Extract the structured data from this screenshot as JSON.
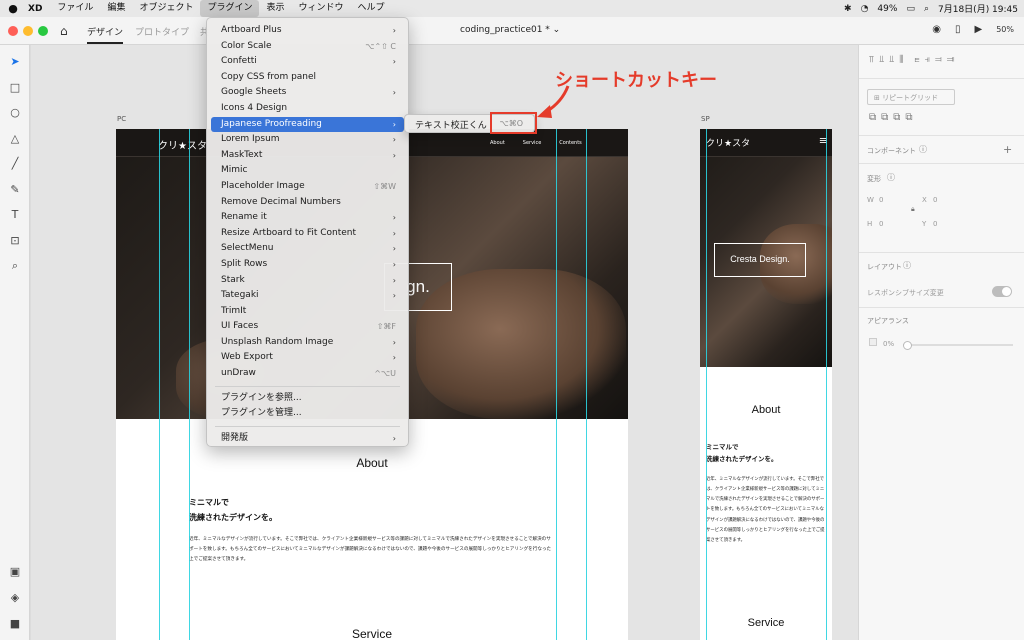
{
  "menubar": {
    "app_name": "XD",
    "items": [
      "ファイル",
      "編集",
      "オブジェクト",
      "プラグイン",
      "表示",
      "ウィンドウ",
      "ヘルプ"
    ],
    "status": {
      "battery": "49%",
      "clock": "7月18日(月)  19:45"
    }
  },
  "toolbar": {
    "tabs": [
      "デザイン",
      "プロトタイプ",
      "共"
    ],
    "document_title": "coding_practice01 *",
    "zoom": "50%"
  },
  "plugin_menu": {
    "items": [
      {
        "label": "Artboard Plus",
        "submenu": true
      },
      {
        "label": "Color Scale",
        "shortcut": "⌥⌃⇧ C"
      },
      {
        "label": "Confetti",
        "submenu": true
      },
      {
        "label": "Copy CSS from panel"
      },
      {
        "label": "Google Sheets",
        "submenu": true
      },
      {
        "label": "Icons 4 Design"
      },
      {
        "label": "Japanese Proofreading",
        "submenu": true,
        "highlighted": true
      },
      {
        "label": "Lorem Ipsum",
        "submenu": true
      },
      {
        "label": "MaskText",
        "submenu": true
      },
      {
        "label": "Mimic"
      },
      {
        "label": "Placeholder Image",
        "shortcut": "⇧⌘W"
      },
      {
        "label": "Remove Decimal Numbers"
      },
      {
        "label": "Rename it",
        "submenu": true
      },
      {
        "label": "Resize Artboard to Fit Content",
        "submenu": true
      },
      {
        "label": "SelectMenu",
        "submenu": true
      },
      {
        "label": "Split Rows",
        "submenu": true
      },
      {
        "label": "Stark",
        "submenu": true
      },
      {
        "label": "Tategaki",
        "submenu": true
      },
      {
        "label": "TrimIt"
      },
      {
        "label": "UI Faces",
        "shortcut": "⇧⌘F"
      },
      {
        "label": "Unsplash Random Image",
        "submenu": true
      },
      {
        "label": "Web Export",
        "submenu": true
      },
      {
        "label": "unDraw",
        "shortcut": "^⌥U"
      }
    ],
    "footer_items": [
      "プラグインを参照...",
      "プラグインを管理..."
    ],
    "dev_item": "開発版",
    "submenu": {
      "label": "テキスト校正くん",
      "shortcut": "⌥⌘O"
    }
  },
  "annotation": {
    "text": "ショートカットキー",
    "color": "#e53b2a"
  },
  "artboards": {
    "pc": {
      "label": "PC",
      "logo": "クリ★スタ",
      "nav": [
        "About",
        "Service",
        "Contents"
      ],
      "hero_title": "gn.",
      "about_title": "About",
      "heading": [
        "ミニマルで",
        "洗練されたデザインを。"
      ],
      "body": "近年、ミニマルなデザインが流行しています。そこで弊社では、クライアント企業様新規サービス等の課題に対してミニマルで洗練されたデザインを実現させることで解決のサポートを致します。もちろん全てのサービスにおいてミニマルなデザインが課題解決になるわけではないので、課題や今後のサービスの展開等しっかりとヒアリングを行なった上でご提案させて頂きます。",
      "service_title": "Service"
    },
    "sp": {
      "label": "SP",
      "logo": "クリ★スタ",
      "hero_title": "Cresta Design.",
      "about_title": "About",
      "heading": [
        "ミニマルで",
        "洗練されたデザインを。"
      ],
      "body": "近年、ミニマルなデザインが流行しています。そこで弊社では、クライアント企業様新規サービス等の課題に対してミニマルで洗練されたデザインを実現させることで解決のサポートを致します。もちろん全てのサービスにおいてミニマルなデザインが課題解決になるわけではないので、課題や今後のサービスの展開等しっかりとヒアリングを行なった上でご提案させて頂きます。",
      "service_title": "Service"
    }
  },
  "right_panel": {
    "repeat_grid": "リピートグリッド",
    "component": "コンポーネント",
    "transform": "変形",
    "w_label": "W",
    "w_value": "0",
    "x_label": "X",
    "x_value": "0",
    "h_label": "H",
    "h_value": "0",
    "y_label": "Y",
    "y_value": "0",
    "layout": "レイアウト",
    "responsive": "レスポンシブサイズ変更",
    "appearance": "アピアランス",
    "opacity": "0%"
  }
}
